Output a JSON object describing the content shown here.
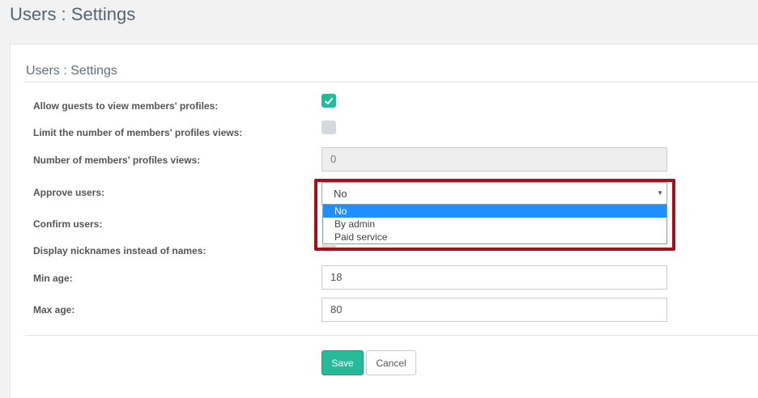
{
  "page": {
    "title": "Users : Settings"
  },
  "panel": {
    "title": "Users : Settings"
  },
  "fields": {
    "allow_guests": {
      "label": "Allow guests to view members' profiles:",
      "checked": true
    },
    "limit_views": {
      "label": "Limit the number of members' profiles views:",
      "checked": false
    },
    "num_views": {
      "label": "Number of members' profiles views:",
      "value": "0"
    },
    "approve_users": {
      "label": "Approve users:",
      "value": "No",
      "options": [
        "No",
        "By admin",
        "Paid service"
      ],
      "selected_index": 0
    },
    "confirm_users": {
      "label": "Confirm users:"
    },
    "display_nicknames": {
      "label": "Display nicknames instead of names:"
    },
    "min_age": {
      "label": "Min age:",
      "value": "18"
    },
    "max_age": {
      "label": "Max age:",
      "value": "80"
    }
  },
  "buttons": {
    "save": "Save",
    "cancel": "Cancel"
  },
  "icons": {
    "checkbox_checked": "check-icon",
    "select_arrow": "triangle-down-icon"
  },
  "colors": {
    "accent": "#26b99a",
    "highlight": "#a1111d",
    "selected_option": "#1e90ff"
  }
}
